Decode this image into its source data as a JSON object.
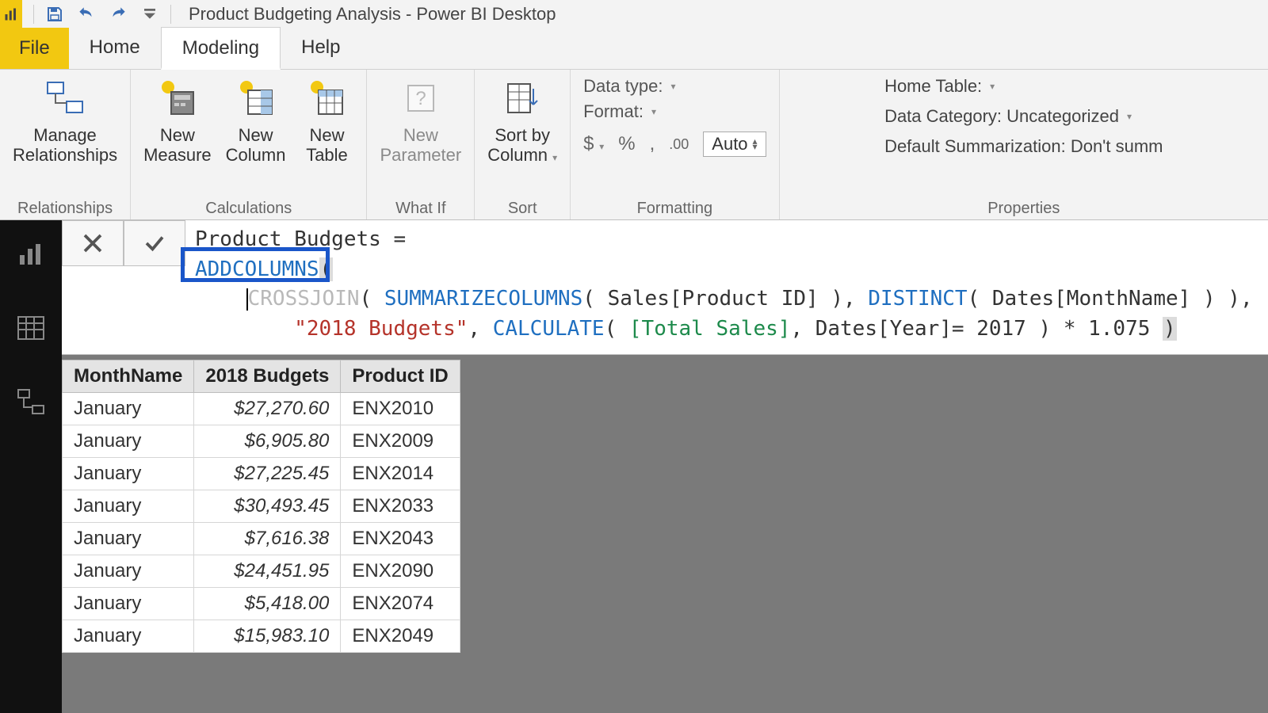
{
  "titlebar": {
    "title": "Product Budgeting Analysis - Power BI Desktop"
  },
  "tabs": {
    "file": "File",
    "items": [
      "Home",
      "Modeling",
      "Help"
    ],
    "active": 1
  },
  "ribbon": {
    "relationships": {
      "manage": "Manage\nRelationships",
      "group": "Relationships"
    },
    "calculations": {
      "measure": "New\nMeasure",
      "column": "New\nColumn",
      "table": "New\nTable",
      "group": "Calculations"
    },
    "whatif": {
      "param": "New\nParameter",
      "group": "What If"
    },
    "sort": {
      "sortby": "Sort by\nColumn",
      "group": "Sort"
    },
    "formatting": {
      "datatype": "Data type:",
      "format": "Format:",
      "currency": "$",
      "percent": "%",
      "comma": ",",
      "decimals": ".00",
      "auto": "Auto",
      "group": "Formatting"
    },
    "properties": {
      "hometable": "Home Table:",
      "datacat": "Data Category: Uncategorized",
      "summ": "Default Summarization: Don't summ",
      "group": "Properties"
    }
  },
  "formula": {
    "name": "Product Budgets",
    "equals": "=",
    "tokens": {
      "addcolumns": "ADDCOLUMNS",
      "crossjoin": "CROSSJOIN",
      "summarizecolumns": "SUMMARIZECOLUMNS",
      "sales_product": "Sales[Product ID]",
      "distinct": "DISTINCT",
      "dates_month": "Dates[MonthName]",
      "str_budget": "\"2018 Budgets\"",
      "calculate": "CALCULATE",
      "total_sales": "[Total Sales]",
      "dates_year": "Dates[Year]",
      "eq": "=",
      "year": "2017",
      "mult": "* 1.075"
    }
  },
  "table": {
    "headers": [
      "MonthName",
      "2018 Budgets",
      "Product ID"
    ],
    "rows": [
      [
        "January",
        "$27,270.60",
        "ENX2010"
      ],
      [
        "January",
        "$6,905.80",
        "ENX2009"
      ],
      [
        "January",
        "$27,225.45",
        "ENX2014"
      ],
      [
        "January",
        "$30,493.45",
        "ENX2033"
      ],
      [
        "January",
        "$7,616.38",
        "ENX2043"
      ],
      [
        "January",
        "$24,451.95",
        "ENX2090"
      ],
      [
        "January",
        "$5,418.00",
        "ENX2074"
      ],
      [
        "January",
        "$15,983.10",
        "ENX2049"
      ]
    ]
  }
}
